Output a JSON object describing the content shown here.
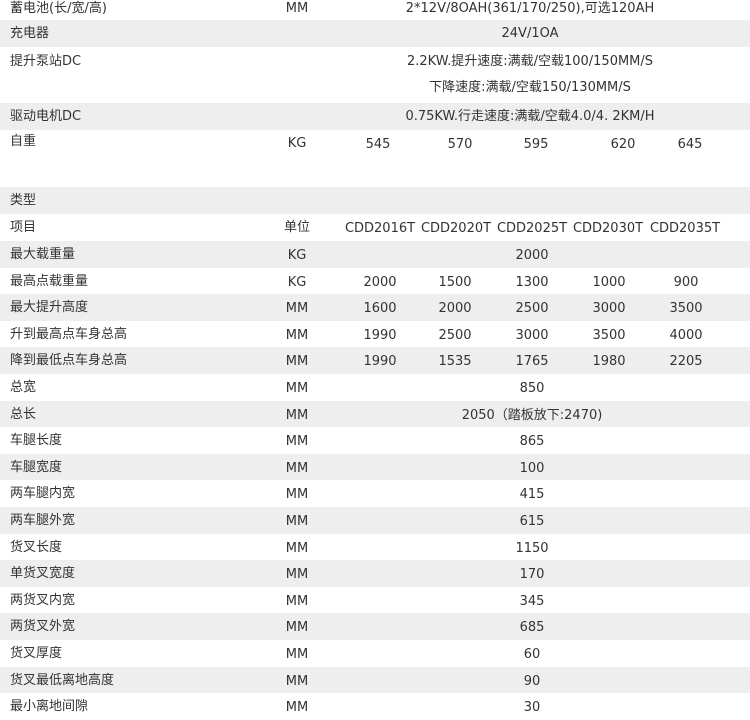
{
  "top_specs": {
    "battery": {
      "label": "蓄电池(长/宽/高)",
      "unit": "MM",
      "value": "2*12V/8OAH(361/170/250),可选120AH"
    },
    "charger": {
      "label": "充电器",
      "unit": "",
      "value": "24V/1OA"
    },
    "lift_pump": {
      "label": "提升泵站DC",
      "unit": "",
      "value": "2.2KW.提升速度:满载/空载100/150MM/S",
      "value2": "下降速度:满载/空载150/130MM/S"
    },
    "drive_motor": {
      "label": "驱动电机DC",
      "unit": "",
      "value": "0.75KW.行走速度:满载/空载4.0/4. 2KM/H"
    },
    "weight": {
      "label": "自重",
      "unit": "KG",
      "values": [
        "545",
        "570",
        "595",
        "620",
        "645"
      ]
    }
  },
  "table": {
    "type_label": "类型",
    "header": {
      "label": "项目",
      "unit": "单位",
      "models": [
        "CDD2016T",
        "CDD2020T",
        "CDD2025T",
        "CDD2030T",
        "CDD2035T"
      ]
    },
    "rows": [
      {
        "label": "最大载重量",
        "unit": "KG",
        "span": "2000"
      },
      {
        "label": "最高点载重量",
        "unit": "KG",
        "values": [
          "2000",
          "1500",
          "1300",
          "1000",
          "900"
        ]
      },
      {
        "label": "最大提升高度",
        "unit": "MM",
        "values": [
          "1600",
          "2000",
          "2500",
          "3000",
          "3500"
        ]
      },
      {
        "label": "升到最高点车身总高",
        "unit": "MM",
        "values": [
          "1990",
          "2500",
          "3000",
          "3500",
          "4000"
        ]
      },
      {
        "label": "降到最低点车身总高",
        "unit": "MM",
        "values": [
          "1990",
          "1535",
          "1765",
          "1980",
          "2205"
        ]
      },
      {
        "label": "总宽",
        "unit": "MM",
        "span": "850"
      },
      {
        "label": "总长",
        "unit": "MM",
        "span": "2050（踏板放下:2470)"
      },
      {
        "label": "车腿长度",
        "unit": "MM",
        "span": "865"
      },
      {
        "label": "车腿宽度",
        "unit": "MM",
        "span": "100"
      },
      {
        "label": "两车腿内宽",
        "unit": "MM",
        "span": "415"
      },
      {
        "label": "两车腿外宽",
        "unit": "MM",
        "span": "615"
      },
      {
        "label": "货叉长度",
        "unit": "MM",
        "span": "1150"
      },
      {
        "label": "单货叉宽度",
        "unit": "MM",
        "span": "170"
      },
      {
        "label": "两货叉内宽",
        "unit": "MM",
        "span": "345"
      },
      {
        "label": "两货叉外宽",
        "unit": "MM",
        "span": "685"
      },
      {
        "label": "货叉厚度",
        "unit": "MM",
        "span": "60"
      },
      {
        "label": "货叉最低离地高度",
        "unit": "MM",
        "span": "90"
      },
      {
        "label": "最小离地间隙",
        "unit": "MM",
        "span": "30"
      }
    ]
  }
}
